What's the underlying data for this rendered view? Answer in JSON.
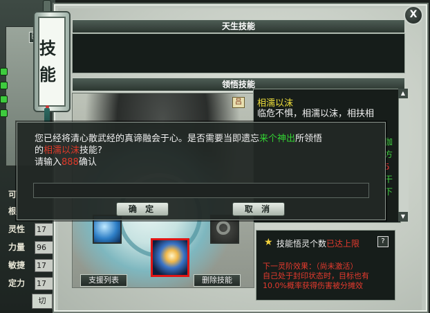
{
  "window": {
    "scroll_tab_title": "技能",
    "close_label": "X"
  },
  "left_panel": {
    "tab_glyph": "巴",
    "stats": [
      {
        "label": "可",
        "value": ""
      },
      {
        "label": "根",
        "value": ""
      },
      {
        "label": "灵性",
        "value": "17"
      },
      {
        "label": "力量",
        "value": "96"
      },
      {
        "label": "敏捷",
        "value": "17"
      },
      {
        "label": "定力",
        "value": "17"
      }
    ],
    "bottom_tab": "切"
  },
  "innate_section": {
    "header": "天生技能"
  },
  "insight_section": {
    "header": "领悟技能",
    "corner_glyph": "吕",
    "support_list_button": "支援列表",
    "delete_skill_button": "删除技能"
  },
  "skill_detail": {
    "name": "相濡以沫",
    "description": "临危不惧，相濡以沫，相扶相",
    "overflow_green": "伽方",
    "overflow_red": "5",
    "overflow_green2": "干下"
  },
  "insight_status": {
    "label": "技能悟灵个数",
    "value": "已达上限",
    "help": "?",
    "next_stage_title": "下一灵阶效果：（尚未激活）",
    "next_stage_text": "自己处于封印状态时，目标也有10.0%概率获得伤害被分摊效"
  },
  "dialog": {
    "line1_prefix": "您已经将清心散武经的真谛融会于心。是否需要当即遗忘",
    "line1_highlight": "来个神出",
    "line1_suffix": "所领悟",
    "line2_prefix": "的",
    "line2_highlight": "相濡以沫",
    "line2_suffix": "技能?",
    "line3_prefix": "请输入",
    "line3_code": "888",
    "line3_suffix": "确认",
    "input_value": "",
    "confirm_button": "确 定",
    "cancel_button": "取 消"
  }
}
